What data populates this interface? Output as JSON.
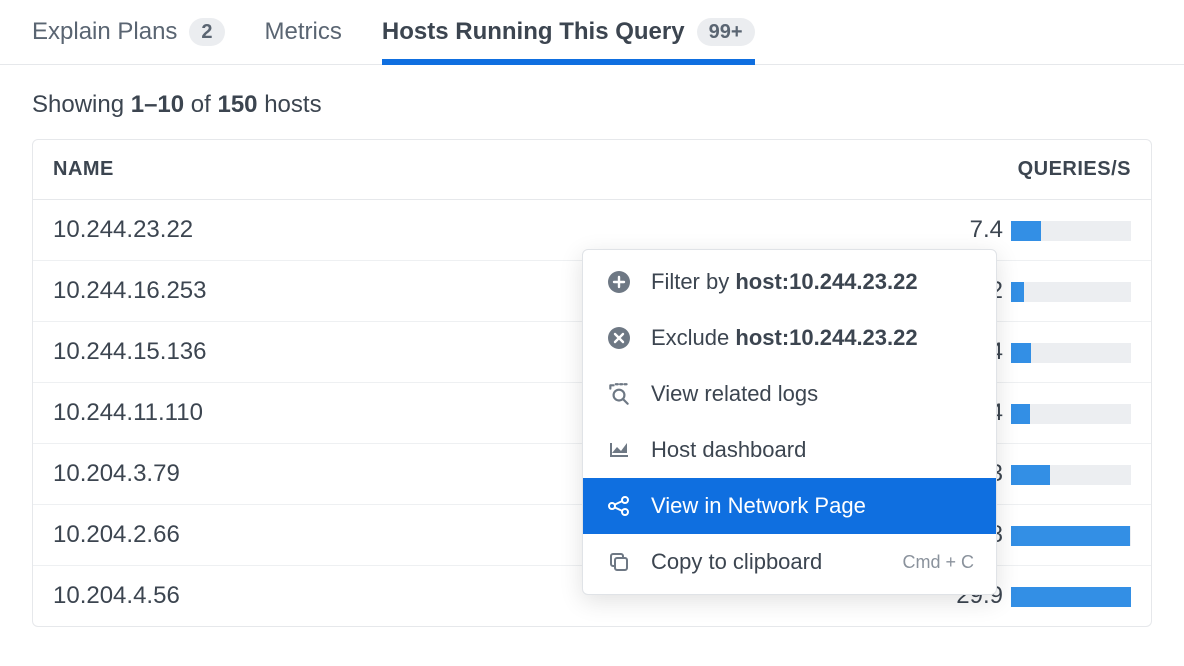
{
  "tabs": {
    "explain_plans": {
      "label": "Explain Plans",
      "badge": "2"
    },
    "metrics": {
      "label": "Metrics"
    },
    "hosts": {
      "label": "Hosts Running This Query",
      "badge": "99+"
    }
  },
  "summary": {
    "prefix": "Showing ",
    "range": "1–10",
    "mid": " of ",
    "total": "150",
    "suffix": " hosts"
  },
  "columns": {
    "name": "NAME",
    "qps": "QUERIES/S"
  },
  "max_qps": 30,
  "rows": [
    {
      "name": "10.244.23.22",
      "qps_display": "7.4",
      "qps": 7.4
    },
    {
      "name": "10.244.16.253",
      "qps_display": "3.32",
      "qps": 3.32
    },
    {
      "name": "10.244.15.136",
      "qps_display": "5.04",
      "qps": 5.04
    },
    {
      "name": "10.244.11.110",
      "qps_display": "4.74",
      "qps": 4.74
    },
    {
      "name": "10.204.3.79",
      "qps_display": "9.63",
      "qps": 9.63
    },
    {
      "name": "10.204.2.66",
      "qps_display": "29.8",
      "qps": 29.8
    },
    {
      "name": "10.204.4.56",
      "qps_display": "29.9",
      "qps": 29.9
    }
  ],
  "context_menu": {
    "target_host": "host:10.244.23.22",
    "filter_prefix": "Filter by ",
    "exclude_prefix": "Exclude ",
    "view_logs": "View related logs",
    "host_dashboard": "Host dashboard",
    "view_network": "View in Network Page",
    "copy": "Copy to clipboard",
    "copy_shortcut": "Cmd + C"
  }
}
